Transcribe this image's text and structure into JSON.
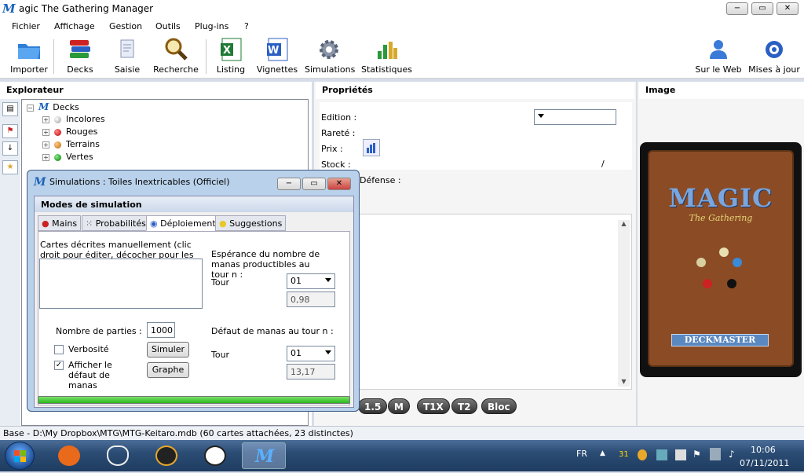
{
  "window": {
    "title": "agic The Gathering Manager",
    "minimize": "−",
    "maximize": "▭",
    "close": "✕"
  },
  "menu": [
    "Fichier",
    "Affichage",
    "Gestion",
    "Outils",
    "Plug-ins",
    "?"
  ],
  "toolbar": {
    "left": [
      {
        "label": "Importer",
        "icon": "folder-icon"
      },
      {
        "label": "Decks",
        "icon": "books-icon"
      },
      {
        "label": "Saisie",
        "icon": "document-icon"
      },
      {
        "label": "Recherche",
        "icon": "magnifier-icon"
      },
      {
        "label": "Listing",
        "icon": "excel-icon"
      },
      {
        "label": "Vignettes",
        "icon": "word-icon"
      },
      {
        "label": "Simulations",
        "icon": "gear-icon"
      },
      {
        "label": "Statistiques",
        "icon": "chart-icon"
      }
    ],
    "right": [
      {
        "label": "Sur le Web",
        "icon": "web-user-icon"
      },
      {
        "label": "Mises à jour",
        "icon": "update-icon"
      }
    ]
  },
  "explorer": {
    "title": "Explorateur",
    "root": "Decks",
    "items": [
      {
        "label": "Incolores",
        "color": "#d0d0d0"
      },
      {
        "label": "Rouges",
        "color": "#d11a1a"
      },
      {
        "label": "Terrains",
        "color": "#d88a22"
      },
      {
        "label": "Vertes",
        "color": "#1ea83a"
      }
    ]
  },
  "properties": {
    "title": "Propriétés",
    "edition": "Edition :",
    "rarete": "Rareté :",
    "prix": "Prix :",
    "stock": "Stock :",
    "stock_sep": "/",
    "defense": "Défense :"
  },
  "image_panel": {
    "title": "Image",
    "card_logo": "MAGIC",
    "card_sub": "The Gathering",
    "card_footer": "DECKMASTER"
  },
  "filters": [
    "1.5",
    "M",
    "T1X",
    "T2",
    "Bloc"
  ],
  "status": {
    "text": "Base - D:\\My Dropbox\\MTG\\MTG-Keitaro.mdb  (60 cartes attachées, 23 distinctes)"
  },
  "taskbar": {
    "lang": "FR",
    "time": "10:06",
    "date": "07/11/2011",
    "badge": "31"
  },
  "dialog": {
    "title": "Simulations : Toiles Inextricables (Officiel)",
    "header": "Modes de simulation",
    "tabs": [
      "Mains",
      "Probabilités",
      "Déploiement",
      "Suggestions"
    ],
    "cards_label": "Cartes décrites manuellement  (clic droit pour éditer, décocher pour les ignorer) :",
    "esperance_label": "Espérance du nombre de manas productibles au tour n :",
    "tour1_label": "Tour",
    "tour1_value": "01",
    "esperance_value": "0,98",
    "parties_label": "Nombre de parties :",
    "parties_value": "1000",
    "defaut_label": "Défaut de manas au tour n :",
    "verbosite": "Verbosité",
    "afficher": "Afficher le défaut de manas",
    "simuler": "Simuler",
    "graphe": "Graphe",
    "tour2_label": "Tour",
    "tour2_value": "01",
    "defaut_value": "13,17",
    "progress": 1.0
  }
}
